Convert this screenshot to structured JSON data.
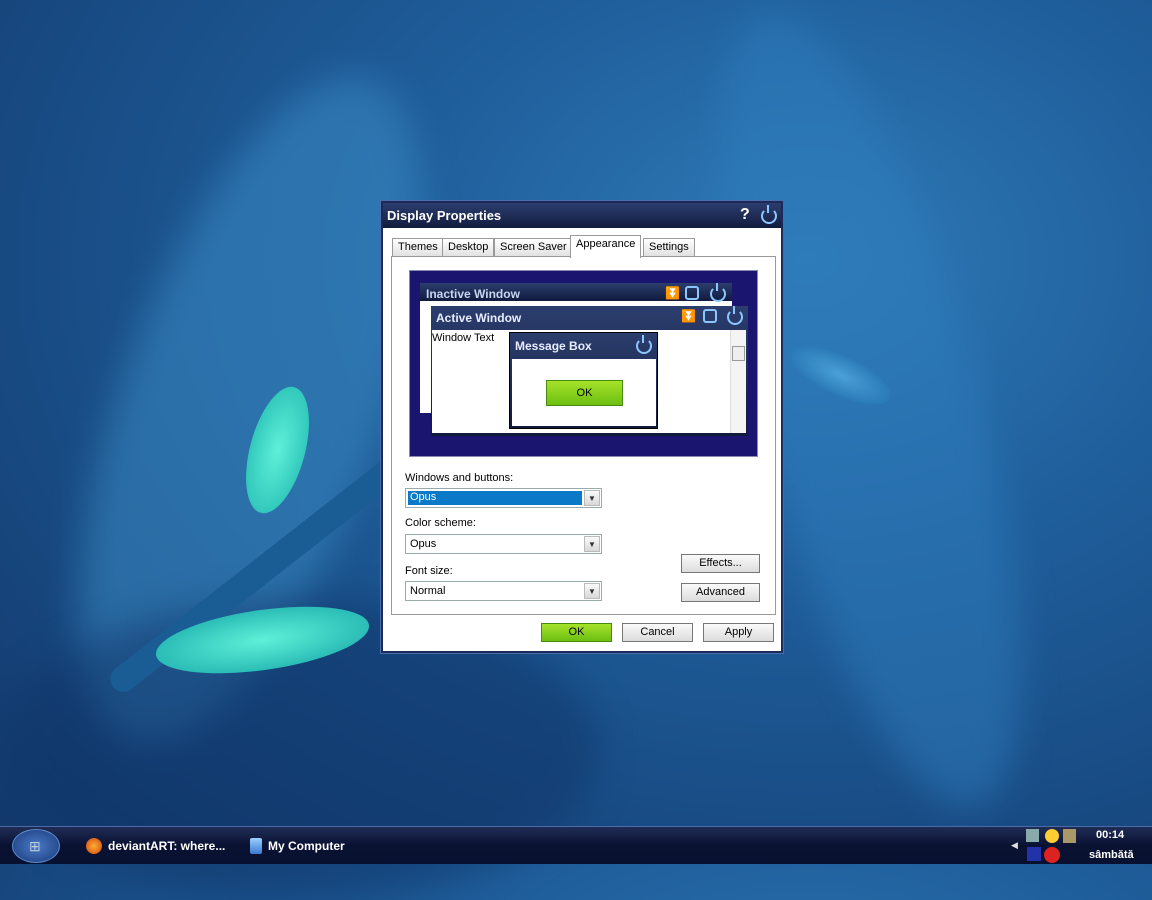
{
  "dialog": {
    "title": "Display Properties",
    "help": "?",
    "tabs": [
      "Themes",
      "Desktop",
      "Screen Saver",
      "Appearance",
      "Settings"
    ],
    "selected_tab": "Appearance",
    "preview": {
      "inactive": "Inactive Window",
      "active": "Active Window",
      "window_text": "Window Text",
      "message_box": "Message Box",
      "ok": "OK"
    },
    "windows_buttons": {
      "label": "Windows and buttons:",
      "value": "Opus"
    },
    "color_scheme": {
      "label": "Color scheme:",
      "value": "Opus"
    },
    "font_size": {
      "label": "Font size:",
      "value": "Normal"
    },
    "effects": "Effects...",
    "advanced": "Advanced",
    "ok": "OK",
    "cancel": "Cancel",
    "apply": "Apply"
  },
  "taskbar": {
    "tasks": [
      {
        "label": "deviantART: where...",
        "icon": "firefox-icon"
      },
      {
        "label": "My Computer",
        "icon": "computer-icon"
      }
    ],
    "clock": {
      "time": "00:14",
      "day": "sâmbătă"
    }
  },
  "colors": {
    "accent_green": "#7ccc1a",
    "selection": "#0a7ac8",
    "preview_bg": "#1a1670"
  }
}
